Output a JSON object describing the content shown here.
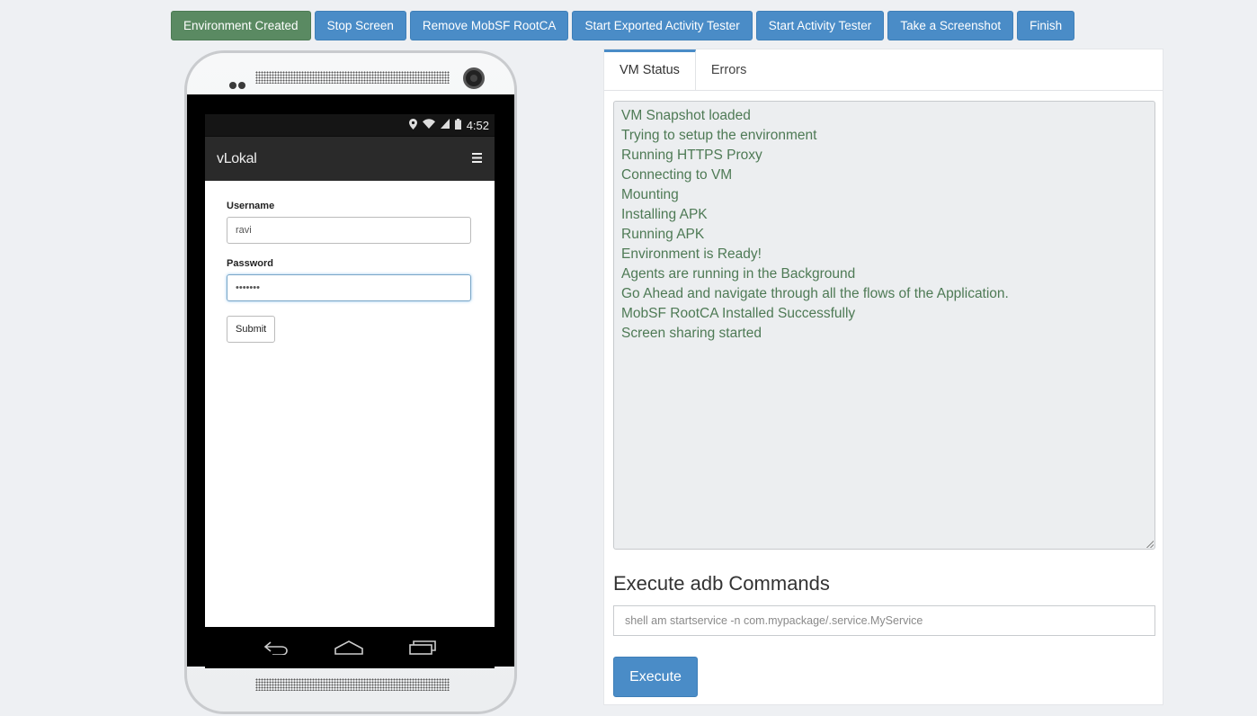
{
  "toolbar": {
    "buttons": [
      {
        "label": "Environment Created",
        "state": "success"
      },
      {
        "label": "Stop Screen"
      },
      {
        "label": "Remove MobSF RootCA"
      },
      {
        "label": "Start Exported Activity Tester"
      },
      {
        "label": "Start Activity Tester"
      },
      {
        "label": "Take a Screenshot"
      },
      {
        "label": "Finish"
      }
    ]
  },
  "device": {
    "status_bar": {
      "time": "4:52",
      "icons": [
        "location-icon",
        "wifi-icon",
        "signal-icon",
        "battery-icon"
      ]
    },
    "app": {
      "title": "vLokal",
      "menu_icon": "hamburger-menu-icon",
      "form": {
        "username_label": "Username",
        "username_value": "ravi",
        "password_label": "Password",
        "password_value": "•••••••",
        "submit_label": "Submit"
      }
    },
    "nav_icons": [
      "back-icon",
      "home-icon",
      "recent-apps-icon"
    ]
  },
  "panel": {
    "tabs": [
      {
        "label": "VM Status",
        "active": true
      },
      {
        "label": "Errors",
        "active": false
      }
    ],
    "log_lines": [
      "VM Snapshot loaded",
      "Trying to setup the environment",
      "Running HTTPS Proxy",
      "Connecting to VM",
      "Mounting",
      "Installing APK",
      "Running APK",
      "Environment is Ready!",
      "Agents are running in the Background",
      "Go Ahead and navigate through all the flows of the Application.",
      "MobSF RootCA Installed Successfully",
      "Screen sharing started"
    ],
    "adb": {
      "heading": "Execute adb Commands",
      "placeholder": "shell am startservice -n com.mypackage/.service.MyService",
      "button_label": "Execute"
    }
  },
  "colors": {
    "primary": "#4a8cc7",
    "success": "#5a8a62",
    "log_text": "#4e7a55",
    "background": "#eef0f3"
  }
}
